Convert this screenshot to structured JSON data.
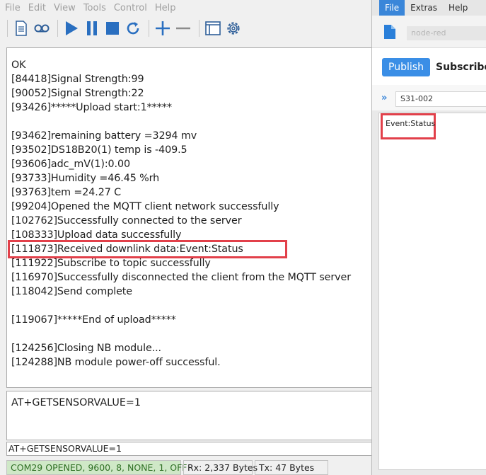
{
  "terminal": {
    "menu": [
      "File",
      "Edit",
      "View",
      "Tools",
      "Control",
      "Help"
    ],
    "toolbar_icons": [
      "document-icon",
      "tape-icon",
      "play-icon",
      "pause-icon",
      "stop-icon",
      "refresh-icon",
      "plus-icon",
      "minus-icon",
      "window-icon",
      "gear-icon"
    ],
    "output_lines": [
      "OK",
      "[84418]Signal Strength:99",
      "[90052]Signal Strength:22",
      "[93426]*****Upload start:1*****",
      "",
      "[93462]remaining battery =3294 mv",
      "[93502]DS18B20(1) temp is -409.5",
      "[93606]adc_mV(1):0.00",
      "[93733]Humidity =46.45 %rh",
      "[93763]tem =24.27 C",
      "[99204]Opened the MQTT client network successfully",
      "[102762]Successfully connected to the server",
      "[108333]Upload data successfully",
      "[111873]Received downlink data:Event:Status",
      "[111922]Subscribe to topic successfully",
      "[116970]Successfully disconnected the client from the MQTT server",
      "[118042]Send complete",
      "",
      "[119067]*****End of upload*****",
      "",
      "[124256]Closing NB module...",
      "[124288]NB module power-off successful."
    ],
    "highlight_index": 13,
    "input_text": "AT+GETSENSORVALUE=1",
    "command_field": "AT+GETSENSORVALUE=1",
    "status": {
      "connection": "COM29 OPENED, 9600, 8, NONE, 1, OFF",
      "rx": "Rx: 2,337 Bytes",
      "tx": "Tx: 47 Bytes"
    },
    "colors": {
      "highlight": "#e2404a",
      "status_ok_bg": "#cfe8c7",
      "status_ok_text": "#2f6f24"
    }
  },
  "mqtt": {
    "menu": {
      "file": "File",
      "extras": "Extras",
      "help": "Help"
    },
    "connection_name": "node-red",
    "publish_label": "Publish",
    "subscribe_label": "Subscribe",
    "topic": "S31-002",
    "message": "Event:Status",
    "colors": {
      "accent": "#3a86d9",
      "highlight": "#e2404a"
    }
  }
}
